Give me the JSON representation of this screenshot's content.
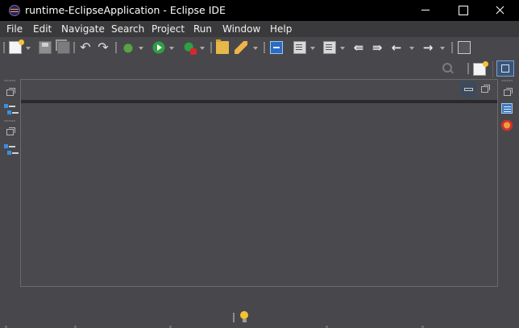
{
  "window": {
    "title": "runtime-EclipseApplication - Eclipse IDE",
    "app_icon": "eclipse-icon",
    "controls": [
      "minimize-icon",
      "maximize-icon",
      "close-icon"
    ]
  },
  "menu": {
    "items": [
      "File",
      "Edit",
      "Navigate",
      "Search",
      "Project",
      "Run",
      "Window",
      "Help"
    ]
  },
  "toolbar": {
    "icons": [
      "new-wizard-icon",
      "save-icon",
      "save-all-icon",
      "undo-icon",
      "redo-icon",
      "debug-icon",
      "run-icon",
      "run-external-tool-icon",
      "open-type-icon",
      "pencil-icon",
      "toggle-block-icon",
      "open-task-icon",
      "next-annotation-icon",
      "back-edit-icon",
      "forward-edit-icon",
      "back-icon",
      "forward-icon",
      "open-perspective-icon"
    ]
  },
  "perspective": {
    "search_icon": "search-icon",
    "open_perspective_icon": "open-perspective-icon",
    "active_perspective_icon": "plugin-development-perspective-icon"
  },
  "left_trim": {
    "icons": [
      "restore-icon",
      "package-explorer-icon",
      "restore-icon",
      "outline-icon"
    ]
  },
  "right_trim": {
    "icons": [
      "restore-icon",
      "task-list-icon",
      "problems-icon"
    ]
  },
  "editor_area": {
    "icons": [
      "minimize-icon",
      "restore-icon"
    ]
  },
  "status": {
    "icon": "lightbulb-icon"
  },
  "colors": {
    "titlebar": "#000000",
    "menubar": "#3a3a3c",
    "background": "#48484c",
    "editor": "#4a4a4e",
    "accent": "#3d8ee0"
  }
}
